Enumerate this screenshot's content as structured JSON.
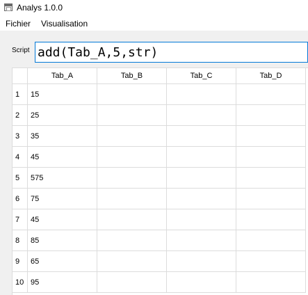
{
  "window": {
    "title": "Analys 1.0.0"
  },
  "menubar": {
    "items": [
      "Fichier",
      "Visualisation"
    ]
  },
  "script": {
    "label": "Script",
    "value": "add(Tab_A,5,str)"
  },
  "table": {
    "columns": [
      "Tab_A",
      "Tab_B",
      "Tab_C",
      "Tab_D"
    ],
    "row_labels": [
      "1",
      "2",
      "3",
      "4",
      "5",
      "6",
      "7",
      "8",
      "9",
      "10"
    ],
    "rows": [
      [
        "15",
        "",
        "",
        ""
      ],
      [
        "25",
        "",
        "",
        ""
      ],
      [
        "35",
        "",
        "",
        ""
      ],
      [
        "45",
        "",
        "",
        ""
      ],
      [
        "575",
        "",
        "",
        ""
      ],
      [
        "75",
        "",
        "",
        ""
      ],
      [
        "45",
        "",
        "",
        ""
      ],
      [
        "85",
        "",
        "",
        ""
      ],
      [
        "65",
        "",
        "",
        ""
      ],
      [
        "95",
        "",
        "",
        ""
      ]
    ]
  }
}
